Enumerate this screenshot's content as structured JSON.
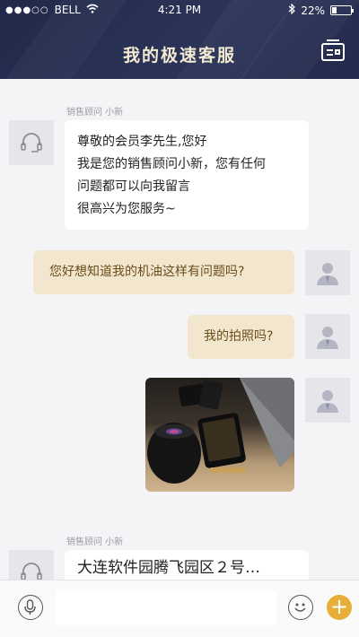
{
  "status_bar": {
    "signal": "●●●○○",
    "carrier": "BELL",
    "time": "4:21 PM",
    "battery": "22%",
    "battery_level": 0.22
  },
  "header": {
    "title": "我的极速客服",
    "title_color": "#f3ead2",
    "bg_color": "#252c4e"
  },
  "messages": [
    {
      "from": "agent",
      "sender": "销售顾问 小新",
      "lines": [
        "尊敬的会员李先生,您好",
        "我是您的销售顾问小新，您有任何",
        "问题都可以向我留言",
        "很高兴为您服务~"
      ]
    },
    {
      "from": "user",
      "text": "您好想知道我的机油这样有问题吗?"
    },
    {
      "from": "user",
      "text": "我的拍照吗?"
    },
    {
      "from": "user",
      "type": "image"
    },
    {
      "from": "agent",
      "sender": "销售顾问 小新",
      "text": "大连软件园腾飞园区２号…"
    }
  ],
  "input_bar": {
    "placeholder": "",
    "accent_color": "#e7ae3a"
  },
  "icons": {
    "agent_avatar": "headset-icon",
    "user_avatar": "user-silhouette-icon",
    "nav_right": "id-card-icon",
    "voice": "microphone-icon",
    "emoji": "smiley-icon",
    "more": "plus-icon"
  }
}
